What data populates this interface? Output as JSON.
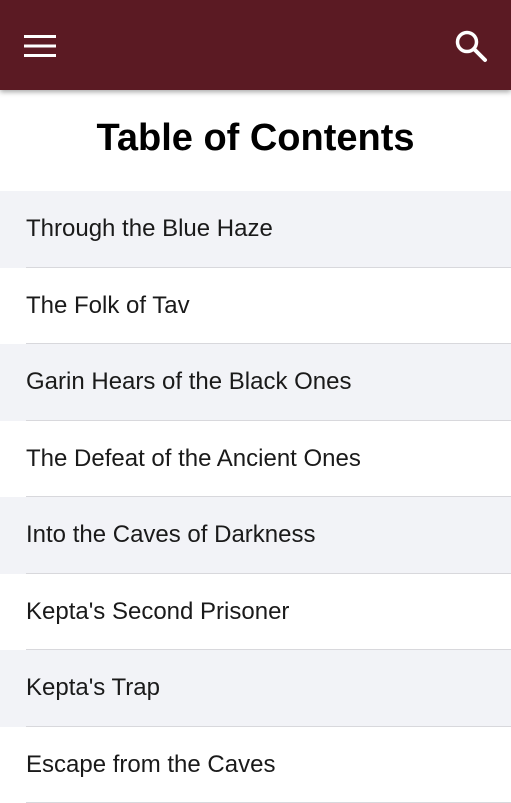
{
  "appbar": {
    "background": "#5b1a23",
    "menu_icon": "hamburger-menu-icon",
    "search_icon": "search-icon"
  },
  "page": {
    "title": "Table of Contents"
  },
  "toc": {
    "items": [
      {
        "label": "Through the Blue Haze"
      },
      {
        "label": "The Folk of Tav"
      },
      {
        "label": "Garin Hears of the Black Ones"
      },
      {
        "label": "The Defeat of the Ancient Ones"
      },
      {
        "label": "Into the Caves of Darkness"
      },
      {
        "label": "Kepta's Second Prisoner"
      },
      {
        "label": "Kepta's Trap"
      },
      {
        "label": "Escape from the Caves"
      }
    ]
  }
}
